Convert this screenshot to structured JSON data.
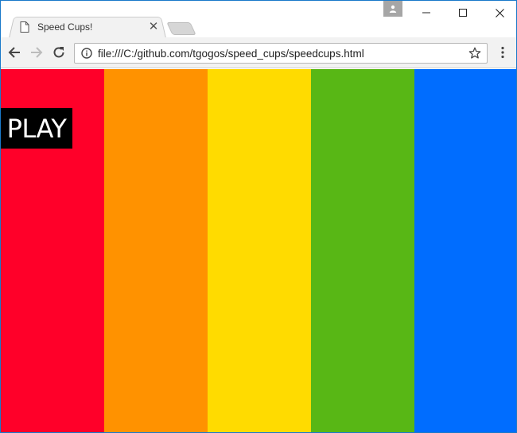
{
  "browser": {
    "tab": {
      "title": "Speed Cups!",
      "close_glyph": "✕",
      "icon": "page-icon"
    },
    "window_controls": {
      "minimize": "minimize-icon",
      "maximize": "maximize-icon",
      "close": "close-icon"
    },
    "toolbar": {
      "back_icon": "arrow-back-icon",
      "forward_icon": "arrow-forward-icon",
      "reload_icon": "reload-icon",
      "url": "file:///C:/github.com/tgogos/speed_cups/speedcups.html",
      "site_info_icon": "info-icon",
      "bookmark_icon": "star-icon",
      "menu_icon": "kebab-menu-icon"
    },
    "accent_color": "#1979ca"
  },
  "page": {
    "play_label": "PLAY",
    "stripes": [
      {
        "name": "red",
        "color": "#ff0029"
      },
      {
        "name": "orange",
        "color": "#ff9200"
      },
      {
        "name": "yellow",
        "color": "#ffdb00"
      },
      {
        "name": "green",
        "color": "#58b715"
      },
      {
        "name": "blue",
        "color": "#006dff"
      }
    ]
  }
}
